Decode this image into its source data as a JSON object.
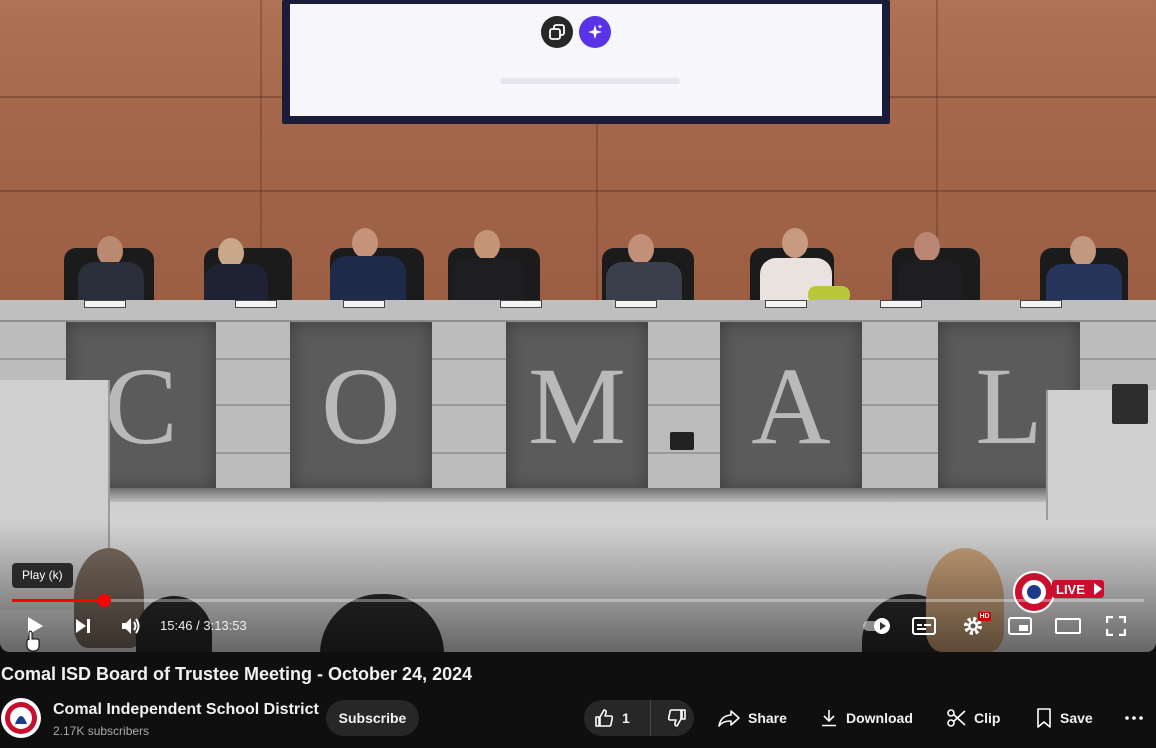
{
  "video": {
    "tooltip": "Play (k)",
    "current_time": "15:46",
    "time_separator": " / ",
    "duration": "3:13:53",
    "progress": 0.081,
    "panel_letters": [
      "C",
      "O",
      "M",
      "A",
      "L"
    ],
    "live_badge_text": "LIVE"
  },
  "info": {
    "title": "Comal ISD Board of Trustee Meeting - October 24, 2024",
    "channel_name": "Comal Independent School District",
    "subscribers": "2.17K subscribers",
    "subscribe_label": "Subscribe",
    "like_count": "1",
    "share_label": "Share",
    "download_label": "Download",
    "clip_label": "Clip",
    "save_label": "Save"
  },
  "colors": {
    "progress": "#ff0000",
    "background": "#0f0f0f",
    "pill": "#272727"
  }
}
